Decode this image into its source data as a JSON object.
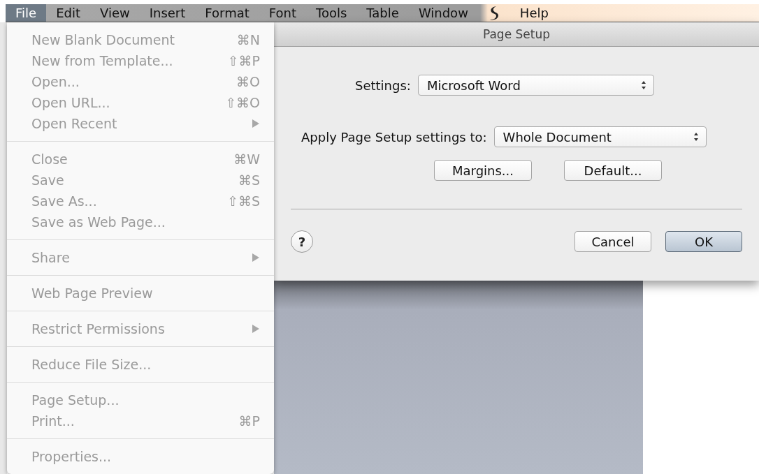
{
  "menu_bar": {
    "items": [
      {
        "label": "File",
        "selected": true
      },
      {
        "label": "Edit",
        "selected": false
      },
      {
        "label": "View",
        "selected": false
      },
      {
        "label": "Insert",
        "selected": false
      },
      {
        "label": "Format",
        "selected": false
      },
      {
        "label": "Font",
        "selected": false
      },
      {
        "label": "Tools",
        "selected": false
      },
      {
        "label": "Table",
        "selected": false
      },
      {
        "label": "Window",
        "selected": false,
        "kind": "highlighted"
      },
      {
        "kind": "icon"
      },
      {
        "label": "Help",
        "selected": false,
        "kind": "highlighted"
      }
    ]
  },
  "file_menu": {
    "groups": [
      [
        {
          "label": "New Blank Document",
          "shortcut": "⌘N",
          "disabled": true,
          "submenu": false
        },
        {
          "label": "New from Template...",
          "shortcut": "⇧⌘P",
          "disabled": true,
          "submenu": false
        },
        {
          "label": "Open...",
          "shortcut": "⌘O",
          "disabled": true,
          "submenu": false
        },
        {
          "label": "Open URL...",
          "shortcut": "⇧⌘O",
          "disabled": true,
          "submenu": false
        },
        {
          "label": "Open Recent",
          "disabled": true,
          "submenu": true
        }
      ],
      [
        {
          "label": "Close",
          "shortcut": "⌘W",
          "disabled": true,
          "submenu": false
        },
        {
          "label": "Save",
          "shortcut": "⌘S",
          "disabled": true,
          "submenu": false
        },
        {
          "label": "Save As...",
          "shortcut": "⇧⌘S",
          "disabled": true,
          "submenu": false
        },
        {
          "label": "Save as Web Page...",
          "disabled": true,
          "submenu": false
        }
      ],
      [
        {
          "label": "Share",
          "disabled": true,
          "submenu": true
        }
      ],
      [
        {
          "label": "Web Page Preview",
          "disabled": true,
          "submenu": false
        }
      ],
      [
        {
          "label": "Restrict Permissions",
          "disabled": true,
          "submenu": true
        }
      ],
      [
        {
          "label": "Reduce File Size...",
          "disabled": true,
          "submenu": false
        }
      ],
      [
        {
          "label": "Page Setup...",
          "disabled": true,
          "submenu": false
        },
        {
          "label": "Print...",
          "shortcut": "⌘P",
          "disabled": true,
          "submenu": false
        }
      ],
      [
        {
          "label": "Properties...",
          "disabled": true,
          "submenu": false
        }
      ]
    ]
  },
  "dialog": {
    "title": "Page Setup",
    "settings": {
      "label": "Settings:",
      "value": "Microsoft Word"
    },
    "apply_to": {
      "label": "Apply Page Setup settings to:",
      "value": "Whole Document"
    },
    "option_buttons": [
      {
        "label": "Margins...",
        "default": false
      },
      {
        "label": "Default...",
        "default": false
      }
    ],
    "help_button": {
      "label": "?"
    },
    "action_buttons": [
      {
        "label": "Cancel",
        "default": false
      },
      {
        "label": "OK",
        "default": true
      }
    ]
  }
}
